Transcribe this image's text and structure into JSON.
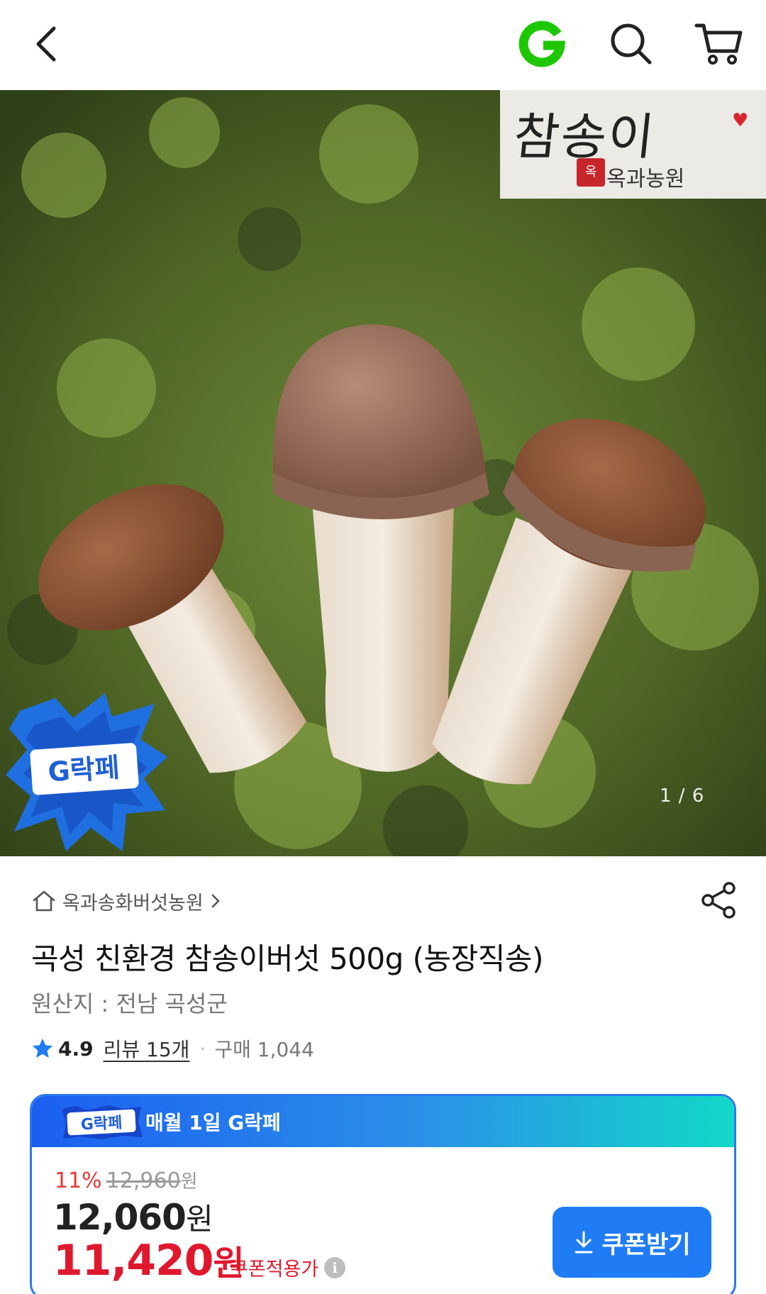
{
  "header": {
    "back_icon": "back-arrow-icon",
    "logo": "G",
    "search_icon": "search-icon",
    "cart_icon": "cart-icon"
  },
  "gallery": {
    "brand_logo_text": "참송이",
    "brand_logo_sub": "옥과농원",
    "badge_text": "G락페",
    "counter": "1 / 6"
  },
  "product": {
    "store_name": "옥과송화버섯농원",
    "title": "곡성 친환경 참송이버섯 500g (농장직송)",
    "origin": "원산지 : 전남 곡성군",
    "rating": "4.9",
    "review_text": "리뷰 15개",
    "purchase_text": "구매 1,044"
  },
  "promo": {
    "badge_text": "G락페",
    "header_text": "매월 1일 G락페",
    "discount_percent": "11%",
    "original_price": "12,960",
    "original_unit": "원",
    "price": "12,060",
    "price_unit": "원",
    "coupon_price": "11,420",
    "coupon_price_unit": "원",
    "coupon_label": "쿠폰적용가",
    "coupon_button": "쿠폰받기"
  },
  "colors": {
    "brand_green": "#1ec800",
    "accent_blue": "#1f7cf5",
    "price_red": "#e0182e"
  }
}
